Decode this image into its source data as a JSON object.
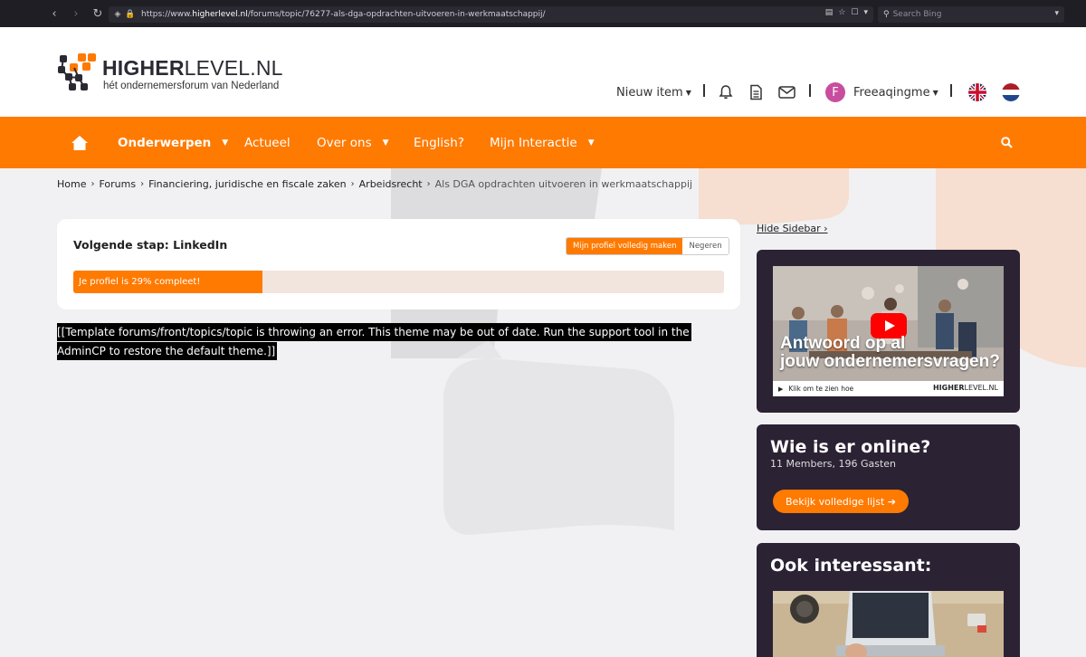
{
  "browser": {
    "url_prefix": "https://www.",
    "url_host": "higherlevel.nl",
    "url_path": "/forums/topic/76277-als-dga-opdrachten-uitvoeren-in-werkmaatschappij/",
    "search_placeholder": "Search Bing"
  },
  "logo": {
    "title_bold": "HIGHER",
    "title_rest": "LEVEL.NL",
    "subtitle": "hét ondernemersforum van Nederland"
  },
  "header": {
    "new_item": "Nieuw item",
    "username": "Freeaqingme",
    "avatar_letter": "F"
  },
  "nav": {
    "items": [
      {
        "label": "Onderwerpen"
      },
      {
        "label": "Actueel"
      },
      {
        "label": "Over ons"
      },
      {
        "label": "English?"
      },
      {
        "label": "Mijn Interactie"
      }
    ]
  },
  "breadcrumb": {
    "items": [
      "Home",
      "Forums",
      "Financiering, juridische en fiscale zaken",
      "Arbeidsrecht"
    ],
    "current": "Als DGA opdrachten uitvoeren in werkmaatschappij"
  },
  "linkedin": {
    "title": "Volgende stap: LinkedIn",
    "primary_button": "Mijn profiel volledig maken",
    "secondary_button": "Negeren",
    "progress_label": "Je profiel is 29% compleet!",
    "progress_percent": 29
  },
  "error_message": "[[Template forums/front/topics/topic is throwing an error. This theme may be out of date. Run the support tool in the AdminCP to restore the default theme.]]",
  "sidebar": {
    "hide_label": "Hide Sidebar",
    "video": {
      "caption_line1": "Antwoord op al",
      "caption_line2": "jouw ondernemersvragen?",
      "foot_text": "Klik om te zien hoe",
      "foot_logo_bold": "HIGHER",
      "foot_logo_rest": "LEVEL.NL"
    },
    "online": {
      "title": "Wie is er online?",
      "subtitle": "11 Members, 196 Gasten",
      "button": "Bekijk volledige lijst"
    },
    "interesting": {
      "title": "Ook interessant:"
    }
  },
  "colors": {
    "accent": "#ff7a00",
    "panel": "#2b2234",
    "background": "#f1f1f3"
  }
}
